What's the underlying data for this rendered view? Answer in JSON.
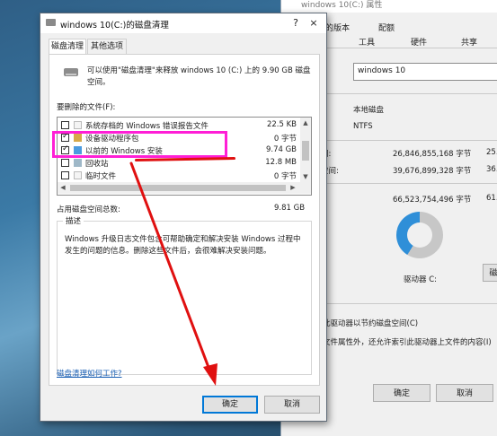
{
  "props": {
    "title": "windows 10(C:) 属性",
    "tabs_row1": [
      "前的版本",
      "配额",
      "共享"
    ],
    "tabs_row2": [
      "工具",
      "硬件",
      "共享"
    ],
    "name_value": "windows 10",
    "type_label_suffix": "本地磁盘",
    "fs_label": "s:",
    "fs_value": "NTFS",
    "used_label": "间:",
    "used_bytes": "26,846,855,168 字节",
    "used_gb": "25.",
    "free_label": "空间:",
    "free_bytes": "39,676,899,328 字节",
    "free_gb": "36.",
    "cap_label": "i:",
    "cap_bytes": "66,523,754,496 字节",
    "cap_gb": "61.",
    "drive_label": "驱动器 C:",
    "right_btn": "磁",
    "compress_text": "此驱动器以节约磁盘空间(C)",
    "index_text": "文件属性外，还允许索引此驱动器上文件的内容(I)",
    "ok": "确定",
    "cancel": "取消",
    "donut_used_fraction": 0.41
  },
  "dialog": {
    "title": "windows 10(C:)的磁盘清理",
    "help_glyph": "?",
    "close_glyph": "×",
    "tabs": [
      "磁盘清理",
      "其他选项"
    ],
    "intro": "可以使用\"磁盘清理\"来释放 windows 10 (C:) 上的 9.90 GB 磁盘空间。",
    "files_label": "要删除的文件(F):",
    "files": [
      {
        "name": "系统存档的 Windows 错误报告文件",
        "size": "22.5 KB",
        "checked": false
      },
      {
        "name": "设备驱动程序包",
        "size": "0 字节",
        "checked": true
      },
      {
        "name": "以前的 Windows 安装",
        "size": "9.74 GB",
        "checked": true
      },
      {
        "name": "回收站",
        "size": "12.8 MB",
        "checked": false
      },
      {
        "name": "临时文件",
        "size": "0 字节",
        "checked": false
      }
    ],
    "total_label": "占用磁盘空间总数:",
    "total_value": "9.81 GB",
    "desc_legend": "描述",
    "desc_text": "Windows 升级日志文件包含可帮助确定和解决安装 Windows 过程中发生的问题的信息。删除这些文件后，会很难解决安装问题。",
    "help_link": "磁盘清理如何工作?",
    "ok": "确定",
    "cancel": "取消"
  },
  "colors": {
    "highlight": "#ff1fd6",
    "arrow": "#e01010",
    "donut_free": "#c7c7c7",
    "donut_used": "#2f8fd8"
  }
}
